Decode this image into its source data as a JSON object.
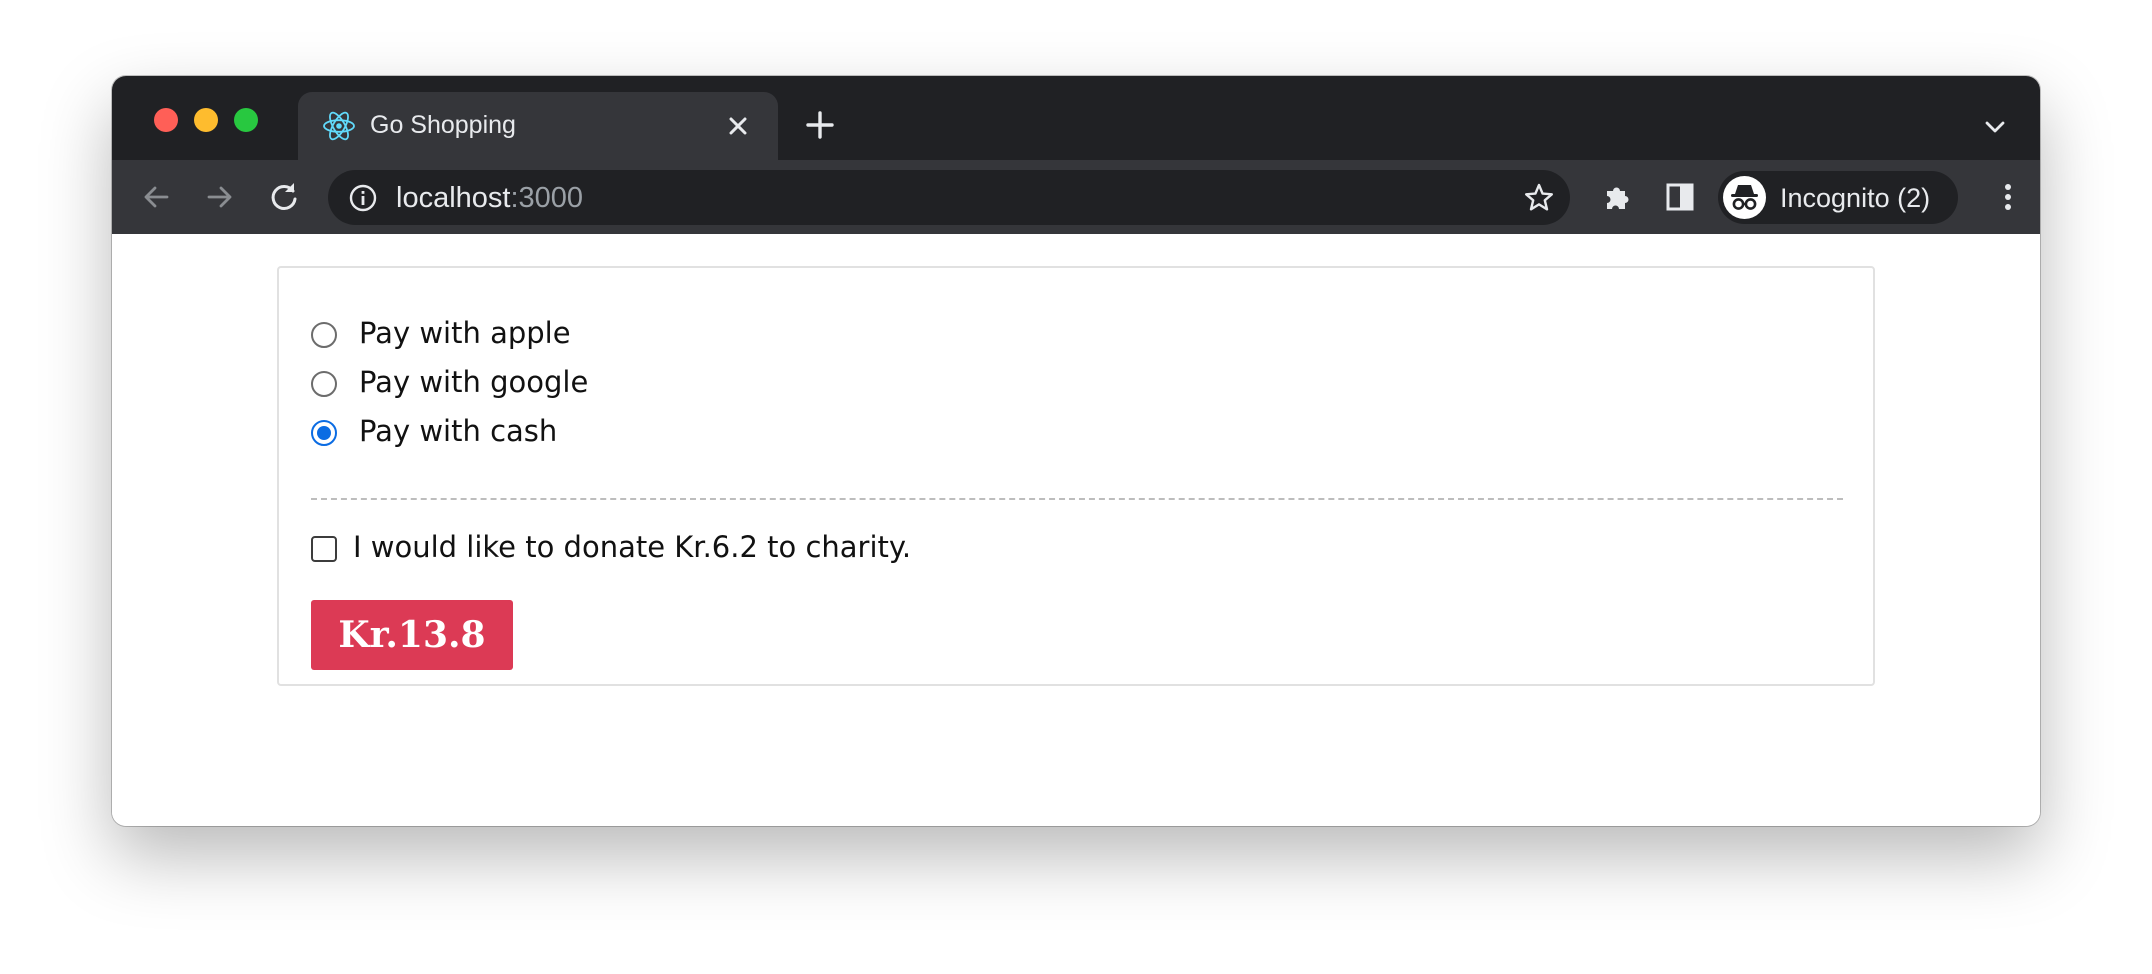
{
  "browser": {
    "tab": {
      "title": "Go Shopping",
      "favicon": "react-icon"
    },
    "address_bar": {
      "host": "localhost",
      "port": ":3000"
    },
    "profile": {
      "label": "Incognito (2)"
    },
    "colors": {
      "frame": "#202124",
      "toolbar": "#35363a",
      "traffic_red": "#ff5f57",
      "traffic_yellow": "#febc2e",
      "traffic_green": "#28c840"
    }
  },
  "page": {
    "payment_options": [
      {
        "label": "Pay with apple",
        "checked": false
      },
      {
        "label": "Pay with google",
        "checked": false
      },
      {
        "label": "Pay with cash",
        "checked": true
      }
    ],
    "donation": {
      "label": "I would like to donate Kr.6.2 to charity.",
      "checked": false
    },
    "pay_button": {
      "label": "Kr.13.8",
      "color": "#dc3a55"
    },
    "colors": {
      "radio_selected": "#0b6ce3"
    }
  }
}
